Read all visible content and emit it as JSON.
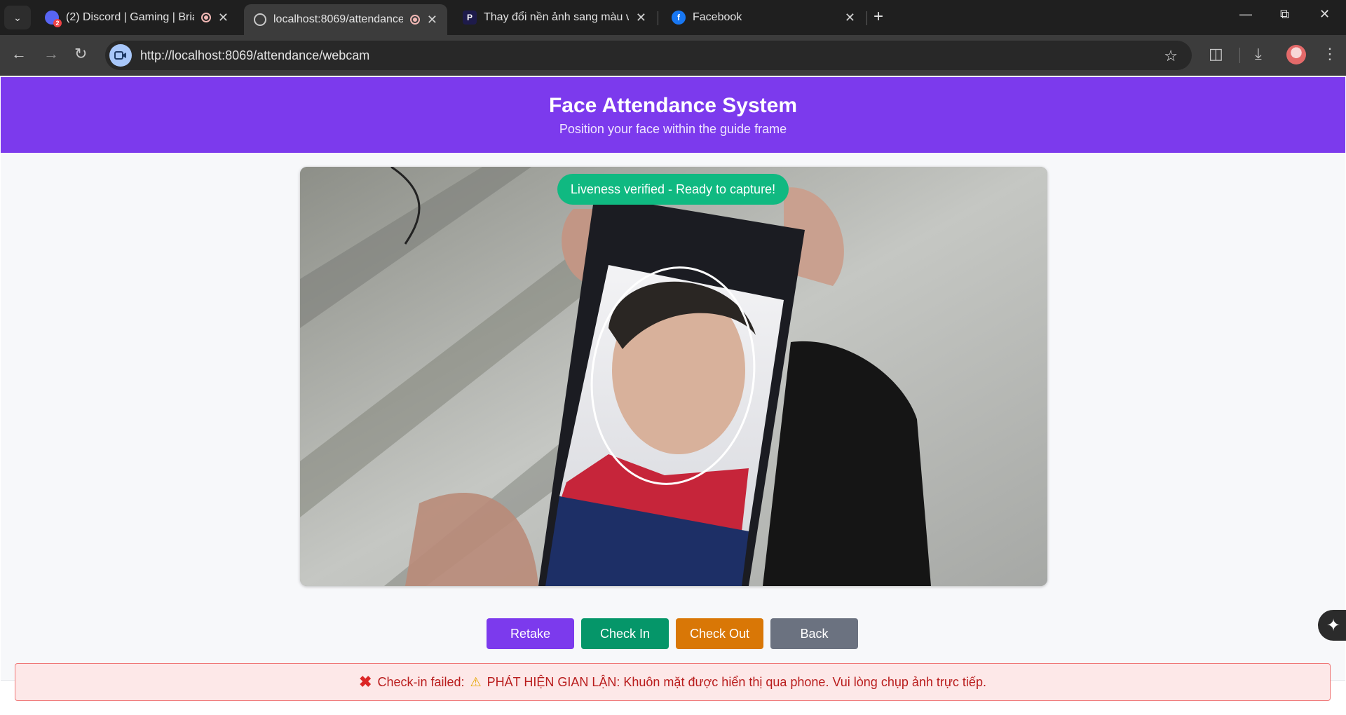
{
  "browser": {
    "tabs": [
      {
        "title": "(2) Discord | Gaming | Brian",
        "favicon": "discord-icon"
      },
      {
        "title": "localhost:8069/attendance/",
        "favicon": "globe-icon"
      },
      {
        "title": "Thay đổi nền ảnh sang màu vàn",
        "favicon": "p-logo-icon"
      },
      {
        "title": "Facebook",
        "favicon": "facebook-icon"
      }
    ],
    "url": "http://localhost:8069/attendance/webcam",
    "discord_badge": "2"
  },
  "header": {
    "title": "Face Attendance System",
    "subtitle": "Position your face within the guide frame"
  },
  "camera": {
    "status": "Liveness verified - Ready to capture!"
  },
  "actions": {
    "retake": "Retake",
    "check_in": "Check In",
    "check_out": "Check Out",
    "back": "Back"
  },
  "error": {
    "prefix": "Check-in failed:",
    "message": "PHÁT HIỆN GIAN LẬN: Khuôn mặt được hiển thị qua phone. Vui lòng chụp ảnh trực tiếp."
  },
  "colors": {
    "header": "#7c3aed",
    "status": "#10b981",
    "retake": "#7c3aed",
    "check_in": "#059669",
    "check_out": "#d97706",
    "back": "#6b7280",
    "error_text": "#b91c1c"
  }
}
